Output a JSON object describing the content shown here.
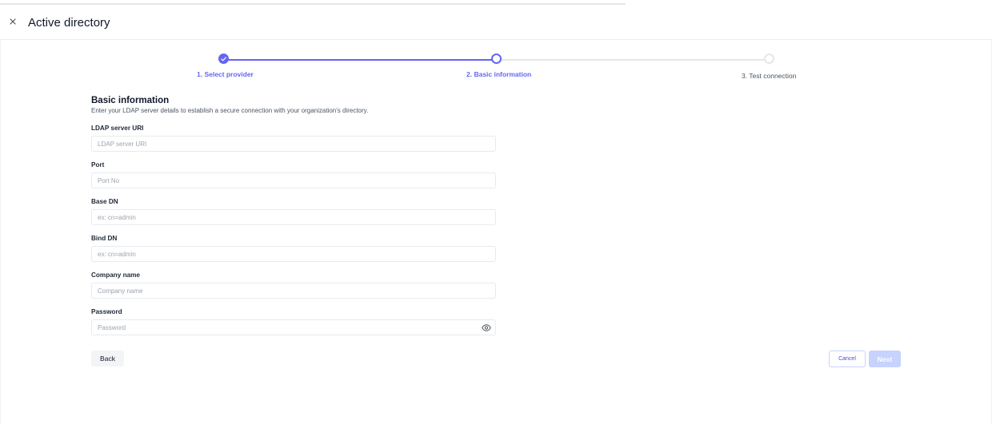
{
  "header": {
    "title": "Active directory"
  },
  "stepper": {
    "steps": [
      {
        "label": "1. Select provider",
        "state": "completed"
      },
      {
        "label": "2. Basic information",
        "state": "active"
      },
      {
        "label": "3. Test connection",
        "state": "pending"
      }
    ]
  },
  "section": {
    "title": "Basic information",
    "description": "Enter your LDAP server details to establish a secure connection with your organization's directory."
  },
  "form": {
    "ldap_uri": {
      "label": "LDAP server URI",
      "placeholder": "LDAP server URI",
      "value": ""
    },
    "port": {
      "label": "Port",
      "placeholder": "Port No",
      "value": ""
    },
    "base_dn": {
      "label": "Base DN",
      "placeholder": "ex: cn=admin",
      "value": ""
    },
    "bind_dn": {
      "label": "Bind DN",
      "placeholder": "ex: cn=admin",
      "value": ""
    },
    "company": {
      "label": "Company name",
      "placeholder": "Company name",
      "value": ""
    },
    "password": {
      "label": "Password",
      "placeholder": "Password",
      "value": ""
    }
  },
  "actions": {
    "back": "Back",
    "cancel": "Cancel",
    "next": "Next"
  },
  "icons": {
    "close": "close-icon",
    "step_done": "check-icon",
    "password_toggle": "eye-icon"
  },
  "colors": {
    "accent": "#6366f1",
    "accent_light": "#c7d2fe",
    "border": "#e8eaee",
    "text": "#1f2937",
    "muted": "#9ca3af"
  }
}
